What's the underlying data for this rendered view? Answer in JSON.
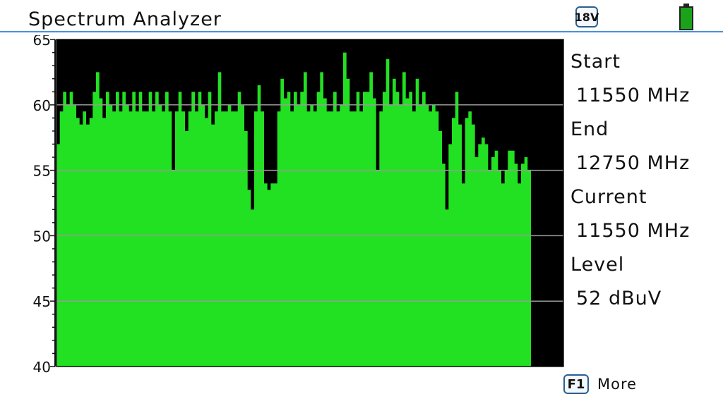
{
  "header": {
    "title": "Spectrum Analyzer",
    "voltage_badge": "18V",
    "battery_level": 1.0,
    "battery_color": "#1aa31a"
  },
  "chart_data": {
    "type": "area",
    "ylim": [
      40,
      65
    ],
    "yticks": [
      "40",
      "45",
      "50",
      "55",
      "60",
      "65"
    ],
    "grid": true,
    "fill_color": "#22e022",
    "background": "#000000",
    "x_start_mhz": 11550,
    "x_end_mhz": 12750,
    "values": [
      57,
      59.5,
      61,
      60,
      61,
      60,
      59,
      58.5,
      59.5,
      58.5,
      59,
      61,
      62.5,
      60.5,
      59,
      61,
      60,
      59.5,
      61,
      59.5,
      61,
      60,
      59.5,
      61,
      59.5,
      61,
      59.5,
      59.5,
      61,
      59.5,
      61,
      60,
      59.5,
      61,
      59.5,
      55,
      59.5,
      61,
      59.5,
      58,
      59.5,
      61,
      59.5,
      61,
      60,
      59,
      61,
      58.5,
      59.5,
      62.5,
      59.5,
      59.5,
      60,
      59.5,
      59.5,
      61,
      60,
      58,
      53.5,
      52,
      59.5,
      61.5,
      59.5,
      54,
      53.5,
      54,
      54,
      59.5,
      62,
      60.5,
      61,
      59.5,
      61,
      60,
      61,
      62.5,
      59.5,
      60,
      59.5,
      61,
      62.5,
      60.5,
      59.5,
      59.5,
      61,
      59.5,
      60,
      64,
      62,
      59.5,
      59.5,
      61,
      59.5,
      61,
      61,
      62.5,
      60.5,
      55,
      59.5,
      61,
      63.5,
      60,
      62,
      61,
      60,
      62.5,
      60.5,
      61,
      59.5,
      62,
      60,
      61,
      60,
      59.5,
      60,
      59.5,
      58,
      55.5,
      52,
      57,
      59,
      61,
      58.5,
      54,
      59,
      59.5,
      58.5,
      56,
      57,
      57.5,
      57,
      55,
      56,
      56.5,
      55,
      54,
      55,
      56.5,
      56.5,
      55.5,
      54,
      55.5,
      56,
      55
    ]
  },
  "side": {
    "start_label": "Start",
    "start_value": "11550 MHz",
    "end_label": "End",
    "end_value": "12750 MHz",
    "current_label": "Current",
    "current_value": "11550 MHz",
    "level_label": "Level",
    "level_value": "52 dBuV"
  },
  "footer": {
    "key_label": "F1",
    "key_text": "More"
  }
}
